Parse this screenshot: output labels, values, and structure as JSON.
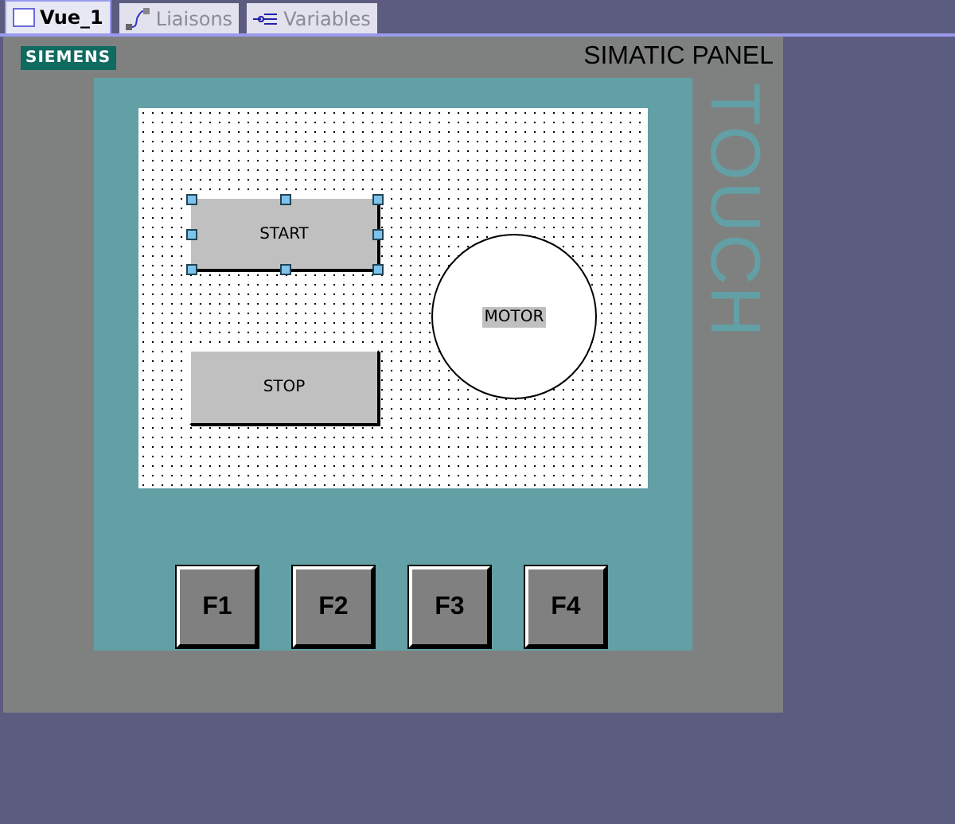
{
  "tabs": [
    {
      "label": "Vue_1",
      "kind": "screen",
      "selected": true
    },
    {
      "label": "Liaisons",
      "kind": "connections",
      "selected": false
    },
    {
      "label": "Variables",
      "kind": "tags",
      "selected": false
    }
  ],
  "panel": {
    "brand": "SIEMENS",
    "model": "SIMATIC PANEL",
    "side_label": "TOUCH"
  },
  "screen_objects": [
    {
      "kind": "button",
      "label": "START",
      "selected": true
    },
    {
      "kind": "button",
      "label": "STOP",
      "selected": false
    },
    {
      "kind": "circle",
      "label": "MOTOR",
      "selected": false
    }
  ],
  "function_keys": [
    "F1",
    "F2",
    "F3",
    "F4"
  ]
}
